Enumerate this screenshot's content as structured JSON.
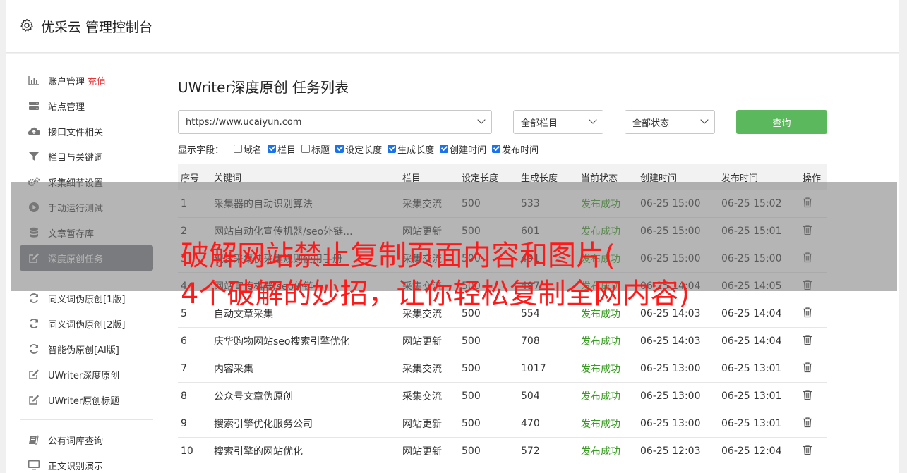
{
  "app": {
    "title": "优采云 管理控制台"
  },
  "sidebar": {
    "items": [
      {
        "label": "账户管理",
        "extra": "充值",
        "icon": "bar-chart-icon"
      },
      {
        "label": "站点管理",
        "icon": "server-icon"
      },
      {
        "label": "接口文件相关",
        "icon": "cloud-upload-icon"
      },
      {
        "label": "栏目与关键词",
        "icon": "filter-icon"
      },
      {
        "label": "采集细节设置",
        "icon": "gears-icon"
      },
      {
        "label": "手动运行测试",
        "icon": "play-circle-icon"
      },
      {
        "label": "文章暂存库",
        "icon": "database-icon"
      },
      {
        "label": "深度原创任务",
        "icon": "edit-icon",
        "active": true
      }
    ],
    "items2": [
      {
        "label": "同义词伪原创[1版]",
        "icon": "refresh-icon"
      },
      {
        "label": "同义词伪原创[2版]",
        "icon": "refresh-icon"
      },
      {
        "label": "智能伪原创[AI版]",
        "icon": "refresh-icon"
      },
      {
        "label": "UWriter深度原创",
        "icon": "edit-icon"
      },
      {
        "label": "UWriter原创标题",
        "icon": "edit-icon"
      }
    ],
    "items3": [
      {
        "label": "公有词库查询",
        "icon": "book-icon"
      },
      {
        "label": "正文识别演示",
        "icon": "monitor-icon"
      }
    ]
  },
  "main": {
    "title": "UWriter深度原创 任务列表",
    "site_select": "https://www.ucaiyun.com",
    "column_select": "全部栏目",
    "status_select": "全部状态",
    "query_label": "查询",
    "fields_label": "显示字段：",
    "fields": [
      {
        "label": "域名",
        "checked": false
      },
      {
        "label": "栏目",
        "checked": true
      },
      {
        "label": "标题",
        "checked": false
      },
      {
        "label": "设定长度",
        "checked": true
      },
      {
        "label": "生成长度",
        "checked": true
      },
      {
        "label": "创建时间",
        "checked": true
      },
      {
        "label": "发布时间",
        "checked": true
      }
    ],
    "columns": [
      "序号",
      "关键词",
      "栏目",
      "设定长度",
      "生成长度",
      "当前状态",
      "创建时间",
      "发布时间",
      "操作"
    ],
    "rows": [
      [
        "1",
        "采集器的自动识别算法",
        "采集交流",
        "500",
        "533",
        "发布成功",
        "06-25 15:00",
        "06-25 15:02"
      ],
      [
        "2",
        "网站自动化宣传机器/seo外链...",
        "网站更新",
        "500",
        "601",
        "发布成功",
        "06-25 15:00",
        "06-25 15:01"
      ],
      [
        "3",
        "织梦采集侠采集规则使用手册",
        "采集交流",
        "500",
        "491",
        "发布成功",
        "06-25 15:00",
        "06-25 15:00"
      ],
      [
        "4",
        "网站宣传机器/seo外链",
        "采集交流",
        "500",
        "497",
        "发布成功",
        "06-25 14:04",
        "06-25 14:05"
      ],
      [
        "5",
        "自动文章采集",
        "采集交流",
        "500",
        "554",
        "发布成功",
        "06-25 14:03",
        "06-25 14:04"
      ],
      [
        "6",
        "庆华购物网站seo搜索引擎优化",
        "网站更新",
        "500",
        "708",
        "发布成功",
        "06-25 14:03",
        "06-25 14:04"
      ],
      [
        "7",
        "内容采集",
        "采集交流",
        "500",
        "1017",
        "发布成功",
        "06-25 13:00",
        "06-25 13:01"
      ],
      [
        "8",
        "公众号文章伪原创",
        "采集交流",
        "500",
        "504",
        "发布成功",
        "06-25 13:00",
        "06-25 13:01"
      ],
      [
        "9",
        "搜索引擎优化服务公司",
        "网站更新",
        "500",
        "470",
        "发布成功",
        "06-25 13:00",
        "06-25 13:01"
      ],
      [
        "10",
        "搜索引擎的网站优化",
        "网站更新",
        "500",
        "572",
        "发布成功",
        "06-25 12:03",
        "06-25 12:04"
      ]
    ]
  },
  "overlay": {
    "line1": "破解网站禁止复制页面内容和图片(",
    "line2": "4个破解的妙招，让你轻松复制全网内容)"
  }
}
